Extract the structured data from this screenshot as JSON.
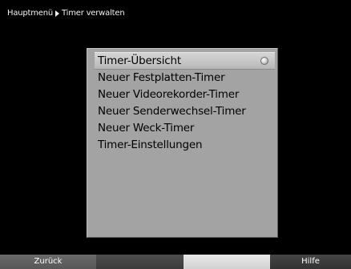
{
  "breadcrumb": {
    "parent": "Hauptmenü",
    "current": "Timer verwalten"
  },
  "menu": {
    "items": [
      {
        "label": "Timer-Übersicht",
        "selected": true
      },
      {
        "label": "Neuer Festplatten-Timer",
        "selected": false
      },
      {
        "label": "Neuer Videorekorder-Timer",
        "selected": false
      },
      {
        "label": "Neuer Senderwechsel-Timer",
        "selected": false
      },
      {
        "label": "Neuer Weck-Timer",
        "selected": false
      },
      {
        "label": "Timer-Einstellungen",
        "selected": false
      }
    ]
  },
  "footer": {
    "red_label": "Zurück",
    "green_label": "",
    "yellow_label": "",
    "blue_label": "Hilfe"
  },
  "colors": {
    "background": "#000000",
    "panel": "#a3a3a3",
    "selection": "#c6c6c6",
    "text": "#000000"
  }
}
